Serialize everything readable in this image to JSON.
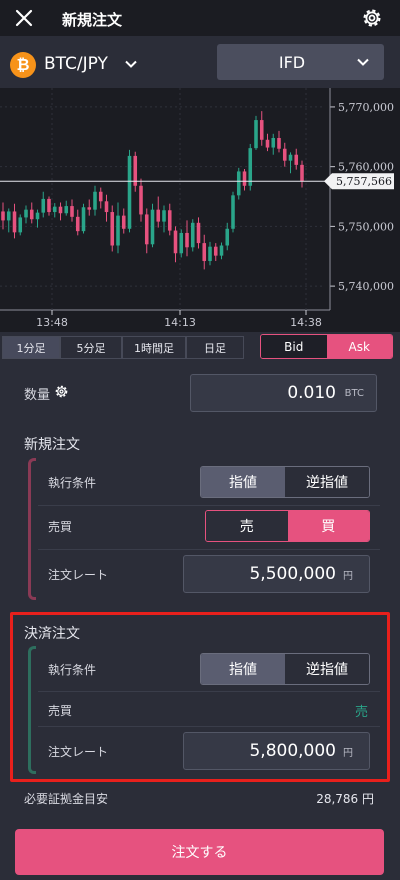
{
  "header": {
    "title": "新規注文",
    "close_icon": "close-icon",
    "settings_icon": "gear-icon"
  },
  "pair_bar": {
    "coin_symbol": "₿",
    "pair": "BTC/JPY",
    "order_type": "IFD"
  },
  "chart_data": {
    "type": "candlestick",
    "x_ticks": [
      "13:48",
      "14:13",
      "14:38"
    ],
    "y_ticks": [
      "5,770,000",
      "5,760,000",
      "5,750,000",
      "5,740,000"
    ],
    "y_tick_values": [
      5770000,
      5760000,
      5750000,
      5740000
    ],
    "current_price_label": "5,757,566",
    "current_price": 5757566,
    "up_color": "#2aa58a",
    "down_color": "#e6527f",
    "candles": [
      [
        5752500,
        5754000,
        5749500,
        5751000
      ],
      [
        5751000,
        5753000,
        5749000,
        5752500
      ],
      [
        5752500,
        5753800,
        5748000,
        5749000
      ],
      [
        5749000,
        5752000,
        5748500,
        5751500
      ],
      [
        5751500,
        5753500,
        5750500,
        5752800
      ],
      [
        5752800,
        5754000,
        5750500,
        5751200
      ],
      [
        5751200,
        5752800,
        5749800,
        5752300
      ],
      [
        5752300,
        5755800,
        5751500,
        5754600
      ],
      [
        5754600,
        5755000,
        5751800,
        5752400
      ],
      [
        5752400,
        5753900,
        5751500,
        5753300
      ],
      [
        5753300,
        5754000,
        5751000,
        5752200
      ],
      [
        5752200,
        5754300,
        5751800,
        5753400
      ],
      [
        5753400,
        5754500,
        5750800,
        5751600
      ],
      [
        5751600,
        5752800,
        5748500,
        5749200
      ],
      [
        5749200,
        5753800,
        5748800,
        5753200
      ],
      [
        5753200,
        5754500,
        5751800,
        5752800
      ],
      [
        5752800,
        5756800,
        5751800,
        5755800
      ],
      [
        5755800,
        5756500,
        5753000,
        5754200
      ],
      [
        5754200,
        5755300,
        5750800,
        5752400
      ],
      [
        5752400,
        5753500,
        5745800,
        5746800
      ],
      [
        5746800,
        5754000,
        5745500,
        5751800
      ],
      [
        5751800,
        5753000,
        5748800,
        5749600
      ],
      [
        5749600,
        5762800,
        5749000,
        5761800
      ],
      [
        5761800,
        5762500,
        5755800,
        5756800
      ],
      [
        5756800,
        5758000,
        5750800,
        5752000
      ],
      [
        5752000,
        5753000,
        5745500,
        5747000
      ],
      [
        5747000,
        5753800,
        5746500,
        5752800
      ],
      [
        5752800,
        5755000,
        5749800,
        5750800
      ],
      [
        5750800,
        5753500,
        5749000,
        5752700
      ],
      [
        5752700,
        5753800,
        5748500,
        5749300
      ],
      [
        5749300,
        5750000,
        5744000,
        5745500
      ],
      [
        5745500,
        5749500,
        5744800,
        5748900
      ],
      [
        5748900,
        5751000,
        5745000,
        5746500
      ],
      [
        5746500,
        5751200,
        5745800,
        5750600
      ],
      [
        5750600,
        5751500,
        5746300,
        5747200
      ],
      [
        5747200,
        5748600,
        5742800,
        5744200
      ],
      [
        5744200,
        5747400,
        5743500,
        5746600
      ],
      [
        5746600,
        5747200,
        5744200,
        5745100
      ],
      [
        5745100,
        5747300,
        5744500,
        5746800
      ],
      [
        5746800,
        5750600,
        5746000,
        5749600
      ],
      [
        5749600,
        5755800,
        5749000,
        5755200
      ],
      [
        5755200,
        5759800,
        5754500,
        5759200
      ],
      [
        5759200,
        5759600,
        5756000,
        5756800
      ],
      [
        5756800,
        5763800,
        5756000,
        5763100
      ],
      [
        5763100,
        5768500,
        5762800,
        5767800
      ],
      [
        5767800,
        5769300,
        5763500,
        5764500
      ],
      [
        5764500,
        5765500,
        5762600,
        5763200
      ],
      [
        5763200,
        5765500,
        5762000,
        5764800
      ],
      [
        5764800,
        5766000,
        5762400,
        5763000
      ],
      [
        5763000,
        5764000,
        5760000,
        5761000
      ],
      [
        5761000,
        5762400,
        5758900,
        5762000
      ],
      [
        5762000,
        5763000,
        5759500,
        5760300
      ],
      [
        5760300,
        5761000,
        5756500,
        5757566
      ]
    ]
  },
  "timeframes": [
    {
      "label": "1分足",
      "active": true
    },
    {
      "label": "5分足",
      "active": false
    },
    {
      "label": "1時間足",
      "active": false
    },
    {
      "label": "日足",
      "active": false
    }
  ],
  "price_side": {
    "bid": "Bid",
    "ask": "Ask",
    "selected": "Ask"
  },
  "quantity": {
    "label": "数量",
    "value": "0.010",
    "unit": "BTC"
  },
  "new_order": {
    "title": "新規注文",
    "condition_label": "執行条件",
    "condition_options": [
      "指値",
      "逆指値"
    ],
    "side_label": "売買",
    "side_options": [
      "売",
      "買"
    ],
    "rate_label": "注文レート",
    "rate_value": "5,500,000",
    "rate_unit": "円"
  },
  "settle_order": {
    "title": "決済注文",
    "condition_label": "執行条件",
    "condition_options": [
      "指値",
      "逆指値"
    ],
    "side_label": "売買",
    "side_value": "売",
    "rate_label": "注文レート",
    "rate_value": "5,800,000",
    "rate_unit": "円"
  },
  "margin": {
    "label": "必要証拠金目安",
    "value": "28,786 円"
  },
  "submit_label": "注文する"
}
